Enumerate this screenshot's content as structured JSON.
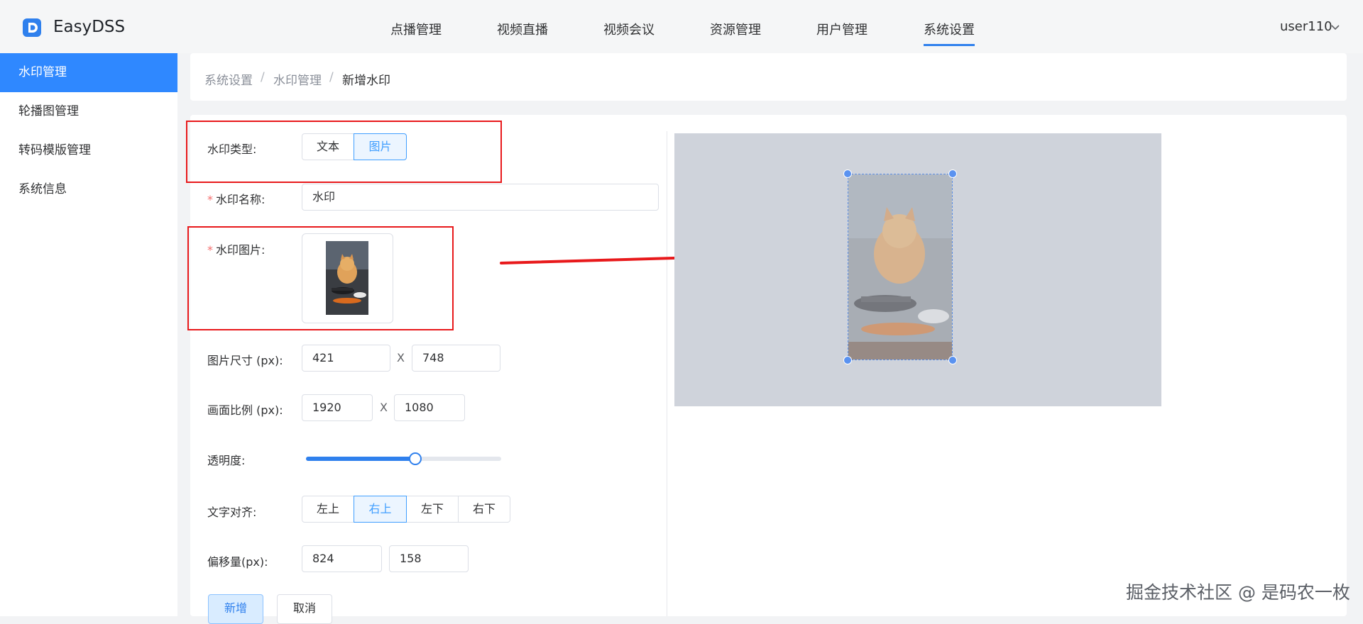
{
  "app": {
    "brand": "EasyDSS"
  },
  "nav": [
    {
      "label": "点播管理"
    },
    {
      "label": "视频直播"
    },
    {
      "label": "视频会议"
    },
    {
      "label": "资源管理"
    },
    {
      "label": "用户管理"
    },
    {
      "label": "系统设置",
      "active": true
    }
  ],
  "user": {
    "name": "user110"
  },
  "sidebar": {
    "items": [
      {
        "label": "水印管理",
        "active": true
      },
      {
        "label": "轮播图管理"
      },
      {
        "label": "转码模版管理"
      },
      {
        "label": "系统信息"
      }
    ]
  },
  "breadcrumb": [
    "系统设置",
    "水印管理",
    "新增水印"
  ],
  "breadcrumb_sep": "/",
  "form": {
    "type_label": "水印类型:",
    "type_options": [
      "文本",
      "图片"
    ],
    "type_selected": "图片",
    "name_label": "水印名称:",
    "name_value": "水印",
    "image_label": "水印图片:",
    "size_label": "图片尺寸 (px):",
    "size_width": "421",
    "size_height": "748",
    "ratio_label": "画面比例 (px):",
    "ratio_width": "1920",
    "ratio_height": "1080",
    "x_mark": "X",
    "opacity_label": "透明度:",
    "opacity_percent": 56,
    "align_label": "文字对齐:",
    "align_options": [
      "左上",
      "右上",
      "左下",
      "右下"
    ],
    "align_selected": "右上",
    "offset_label": "偏移量(px):",
    "offset_x": "824",
    "offset_y": "158",
    "submit_label": "新增",
    "cancel_label": "取消"
  },
  "colors": {
    "primary": "#2f80ed",
    "annotation": "#e8191b",
    "preview_bg": "#cfd3db"
  },
  "footer_watermark": "掘金技术社区 @ 是码农一枚"
}
